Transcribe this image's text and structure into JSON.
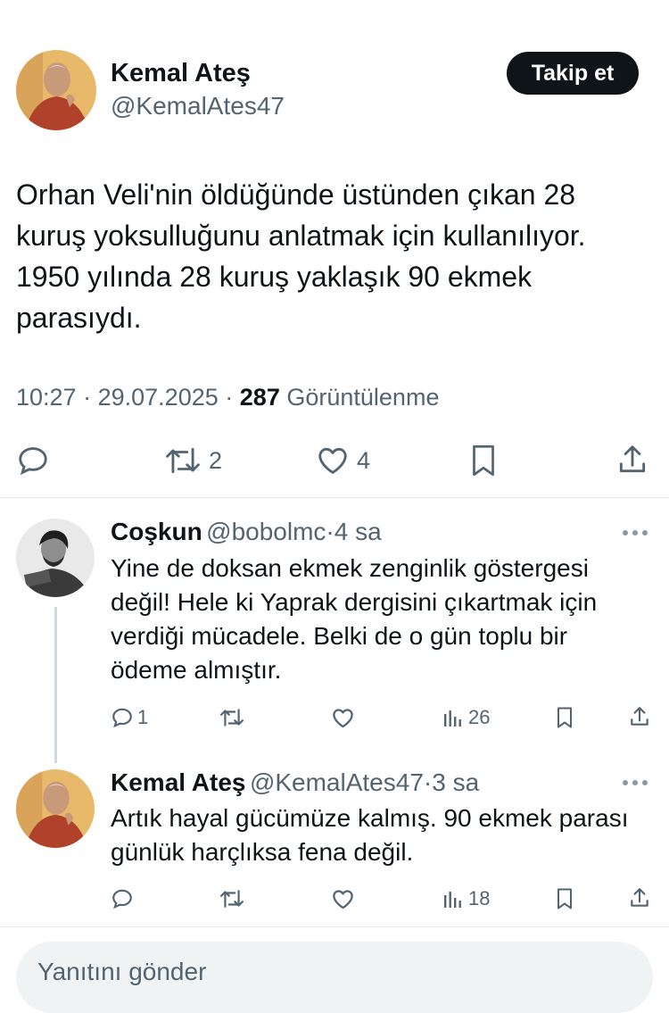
{
  "main_tweet": {
    "author_name": "Kemal Ateş",
    "author_handle": "@KemalAtes47",
    "follow_label": "Takip et",
    "text": "Orhan Veli'nin öldüğünde üstünden çıkan 28 kuruş yoksulluğunu anlatmak için kullanılıyor. 1950 yılında 28 kuruş yaklaşık 90 ekmek parasıydı.",
    "time": "10:27",
    "date": "29.07.2025",
    "views_count": "287",
    "views_label": "Görüntülenme",
    "reply_count": "",
    "retweet_count": "2",
    "like_count": "4"
  },
  "replies": [
    {
      "author_name": "Coşkun",
      "author_handle": "@bobolmc",
      "age": "4 sa",
      "text": "Yine de doksan ekmek zenginlik göstergesi değil! Hele ki Yaprak dergisini çıkartmak için verdiği mücadele. Belki de o gün toplu bir ödeme almıştır.",
      "reply_count": "1",
      "retweet_count": "",
      "like_count": "",
      "views_count": "26"
    },
    {
      "author_name": "Kemal Ateş",
      "author_handle": "@KemalAtes47",
      "age": "3 sa",
      "text": "Artık hayal gücümüze kalmış. 90 ekmek parası günlük harçlıksa fena değil.",
      "reply_count": "",
      "retweet_count": "",
      "like_count": "",
      "views_count": "18"
    }
  ],
  "composer": {
    "placeholder": "Yanıtını gönder"
  },
  "separator": "·",
  "colors": {
    "text": "#0f1419",
    "secondary": "#536471",
    "divider": "#e6e9ec",
    "button": "#0f1419"
  }
}
